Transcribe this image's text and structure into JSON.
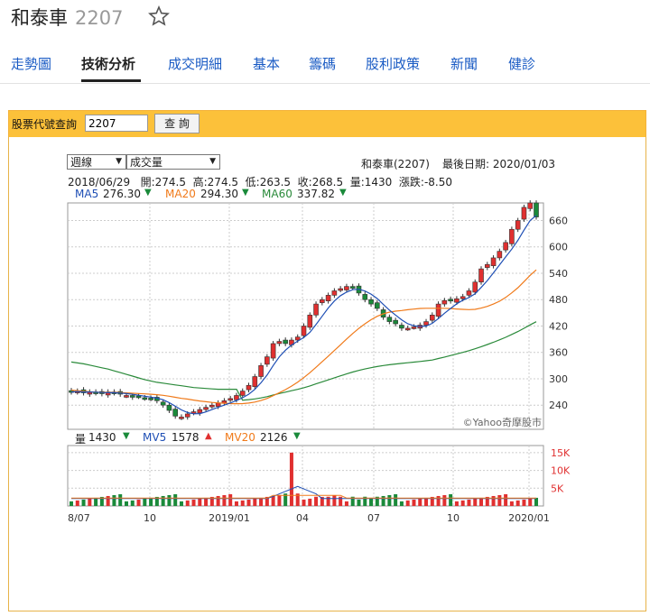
{
  "header": {
    "name": "和泰車",
    "code": "2207"
  },
  "nav": {
    "tabs": [
      "走勢圖",
      "技術分析",
      "成交明細",
      "基本",
      "籌碼",
      "股利政策",
      "新聞",
      "健診"
    ],
    "active": 1
  },
  "query": {
    "label": "股票代號查詢",
    "value": "2207",
    "button": "查 詢"
  },
  "controls": {
    "period": "週線",
    "indicator": "成交量"
  },
  "info": {
    "stock": "和泰車(2207)",
    "last_date_label": "最後日期: 2020/01/03",
    "ohlc_line": "2018/06/29   開:274.5  高:274.5  低:263.5  收:268.5  量:1430  漲跌:-8.50"
  },
  "ma_legend": [
    {
      "label": "MA5",
      "value": "276.30",
      "dir": "down"
    },
    {
      "label": "MA20",
      "value": "294.30",
      "dir": "down"
    },
    {
      "label": "MA60",
      "value": "337.82",
      "dir": "down"
    }
  ],
  "vol_legend": [
    {
      "label": "量",
      "value": "1430",
      "dir": "down"
    },
    {
      "label": "MV5",
      "value": "1578",
      "dir": "up"
    },
    {
      "label": "MV20",
      "value": "2126",
      "dir": "down"
    }
  ],
  "watermark": "©Yahoo奇摩股市",
  "colors": {
    "up": "#e03030",
    "down": "#1a8a3a",
    "ma5": "#1f4fb5",
    "ma20": "#f07a1a",
    "ma60": "#2a8a3a",
    "link": "#1a5bc4"
  },
  "chart_data": [
    {
      "type": "candlestick",
      "title": "和泰車(2207)",
      "ylim": [
        185,
        700
      ],
      "y_ticks": [
        "660",
        "600",
        "540",
        "480",
        "420",
        "360",
        "300",
        "240"
      ],
      "x_ticks": [
        "8/07",
        "10",
        "2019/01",
        "04",
        "07",
        "10",
        "2020/01"
      ],
      "weekly_close_approx": [
        270,
        272,
        268,
        270,
        268,
        266,
        270,
        268,
        265,
        262,
        258,
        260,
        256,
        255,
        250,
        240,
        228,
        215,
        213,
        220,
        225,
        230,
        235,
        240,
        245,
        250,
        255,
        262,
        272,
        285,
        305,
        330,
        350,
        380,
        385,
        380,
        388,
        395,
        420,
        445,
        470,
        480,
        490,
        500,
        505,
        510,
        508,
        495,
        480,
        470,
        460,
        440,
        430,
        425,
        415,
        415,
        418,
        422,
        430,
        445,
        470,
        478,
        477,
        482,
        487,
        500,
        520,
        550,
        560,
        575,
        590,
        610,
        640,
        660,
        690,
        700,
        668
      ]
    },
    {
      "type": "bar",
      "title": "量",
      "y_ticks": [
        "15K",
        "10K",
        "5K"
      ],
      "ylim": [
        0,
        17000
      ],
      "volume_peak_approx": 15000
    }
  ]
}
